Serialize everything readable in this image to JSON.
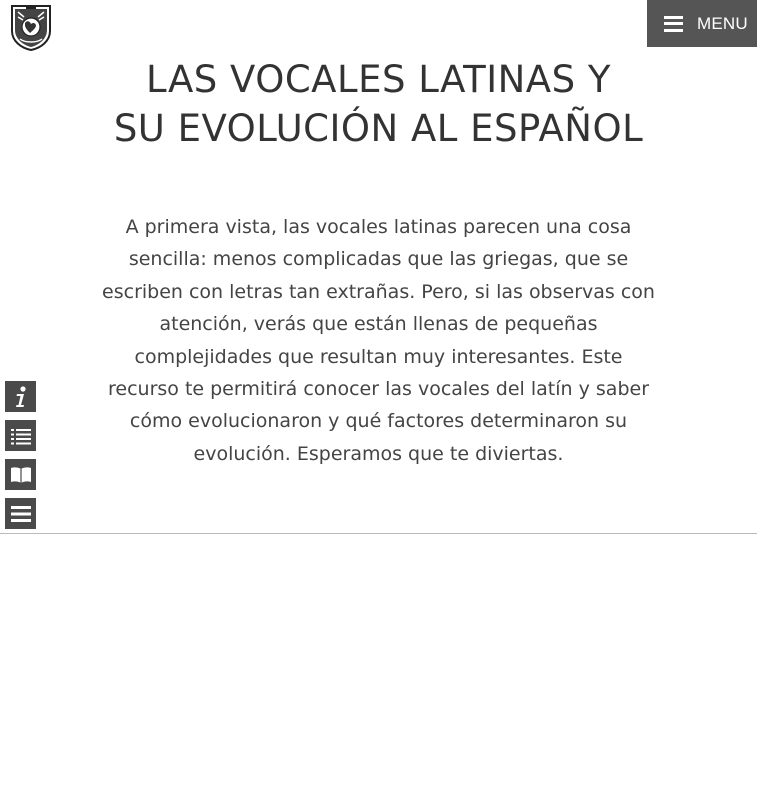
{
  "header": {
    "logo_icon": "university-crest-icon",
    "menu_label": "MENU",
    "menu_icon": "hamburger-icon"
  },
  "main": {
    "title_line1": "LAS VOCALES LATINAS Y",
    "title_line2": "SU EVOLUCIÓN AL ESPAÑOL",
    "intro": "A primera vista, las vocales latinas parecen una cosa sencilla: menos complicadas que las griegas, que se escriben con letras tan extrañas. Pero, si las observas con atención, verás que están llenas de pequeñas complejidades que resultan muy interesantes. Este recurso te permitirá conocer las vocales del latín y saber cómo evolucionaron y qué factores determinaron su evolución. Esperamos que te diviertas."
  },
  "side_tools": [
    {
      "icon": "info-icon"
    },
    {
      "icon": "list-icon"
    },
    {
      "icon": "book-icon"
    },
    {
      "icon": "menu-lines-icon"
    }
  ],
  "colors": {
    "menu_bg": "#555555",
    "tool_bg": "#4a4a4a",
    "title_text": "#333333",
    "body_text": "#444444",
    "divider": "#bbbbbb"
  }
}
